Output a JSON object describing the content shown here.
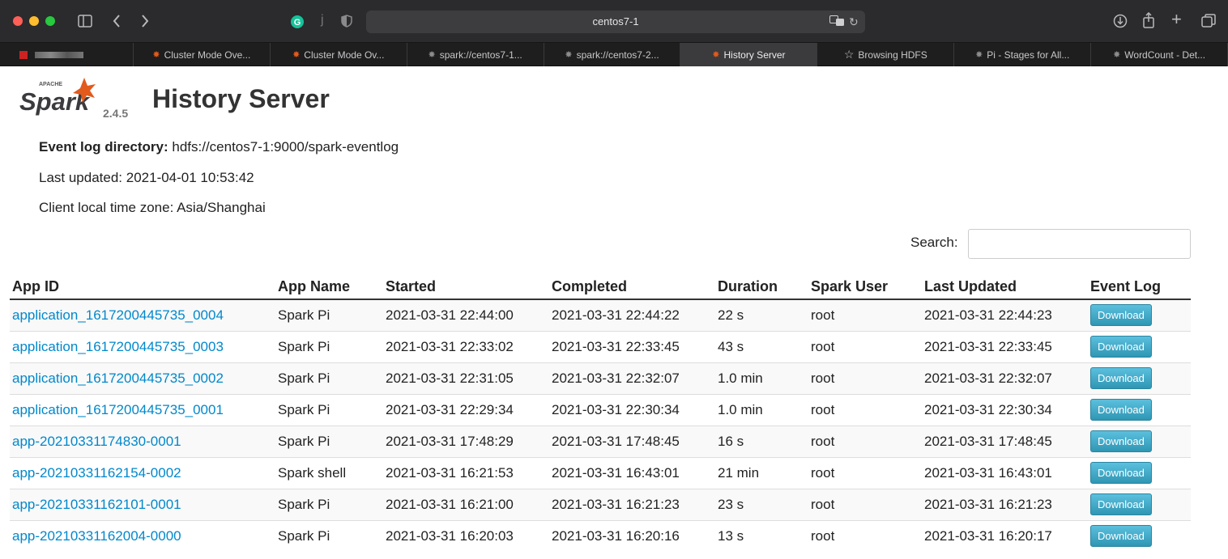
{
  "browser": {
    "address": "centos7-1",
    "tabs": [
      {
        "label": "",
        "icon": "pixelated-favicon"
      },
      {
        "label": "Cluster Mode Ove...",
        "icon": "spark-icon"
      },
      {
        "label": "Cluster Mode Ov...",
        "icon": "spark-icon"
      },
      {
        "label": "spark://centos7-1...",
        "icon": "spark-icon"
      },
      {
        "label": "spark://centos7-2...",
        "icon": "spark-icon"
      },
      {
        "label": "History Server",
        "icon": "spark-icon",
        "active": true
      },
      {
        "label": "Browsing HDFS",
        "icon": "star-icon"
      },
      {
        "label": "Pi - Stages for All...",
        "icon": "spark-icon"
      },
      {
        "label": "WordCount - Det...",
        "icon": "spark-icon"
      }
    ]
  },
  "header": {
    "logo_text": "Spark",
    "logo_apache": "APACHE",
    "version": "2.4.5",
    "title": "History Server"
  },
  "info": {
    "event_log_label": "Event log directory:",
    "event_log_value": "hdfs://centos7-1:9000/spark-eventlog",
    "last_updated": "Last updated: 2021-04-01 10:53:42",
    "time_zone": "Client local time zone: Asia/Shanghai"
  },
  "search": {
    "label": "Search:",
    "value": ""
  },
  "table": {
    "headers": [
      "App ID",
      "App Name",
      "Started",
      "Completed",
      "Duration",
      "Spark User",
      "Last Updated",
      "Event Log"
    ],
    "download_label": "Download",
    "rows": [
      {
        "id": "application_1617200445735_0004",
        "name": "Spark Pi",
        "started": "2021-03-31 22:44:00",
        "completed": "2021-03-31 22:44:22",
        "duration": "22 s",
        "user": "root",
        "updated": "2021-03-31 22:44:23"
      },
      {
        "id": "application_1617200445735_0003",
        "name": "Spark Pi",
        "started": "2021-03-31 22:33:02",
        "completed": "2021-03-31 22:33:45",
        "duration": "43 s",
        "user": "root",
        "updated": "2021-03-31 22:33:45"
      },
      {
        "id": "application_1617200445735_0002",
        "name": "Spark Pi",
        "started": "2021-03-31 22:31:05",
        "completed": "2021-03-31 22:32:07",
        "duration": "1.0 min",
        "user": "root",
        "updated": "2021-03-31 22:32:07"
      },
      {
        "id": "application_1617200445735_0001",
        "name": "Spark Pi",
        "started": "2021-03-31 22:29:34",
        "completed": "2021-03-31 22:30:34",
        "duration": "1.0 min",
        "user": "root",
        "updated": "2021-03-31 22:30:34"
      },
      {
        "id": "app-20210331174830-0001",
        "name": "Spark Pi",
        "started": "2021-03-31 17:48:29",
        "completed": "2021-03-31 17:48:45",
        "duration": "16 s",
        "user": "root",
        "updated": "2021-03-31 17:48:45"
      },
      {
        "id": "app-20210331162154-0002",
        "name": "Spark shell",
        "started": "2021-03-31 16:21:53",
        "completed": "2021-03-31 16:43:01",
        "duration": "21 min",
        "user": "root",
        "updated": "2021-03-31 16:43:01"
      },
      {
        "id": "app-20210331162101-0001",
        "name": "Spark Pi",
        "started": "2021-03-31 16:21:00",
        "completed": "2021-03-31 16:21:23",
        "duration": "23 s",
        "user": "root",
        "updated": "2021-03-31 16:21:23"
      },
      {
        "id": "app-20210331162004-0000",
        "name": "Spark Pi",
        "started": "2021-03-31 16:20:03",
        "completed": "2021-03-31 16:20:16",
        "duration": "13 s",
        "user": "root",
        "updated": "2021-03-31 16:20:17"
      }
    ]
  }
}
